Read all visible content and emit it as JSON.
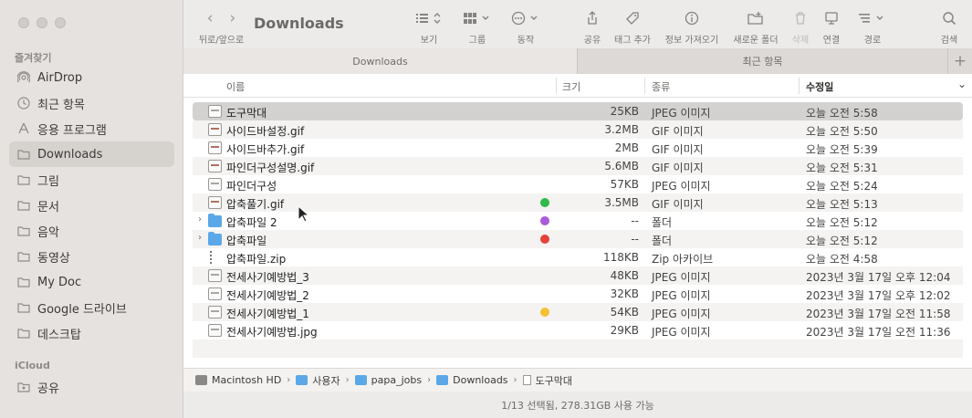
{
  "window": {
    "title": "Downloads"
  },
  "sidebar": {
    "favorites_header": "즐겨찾기",
    "favorites": [
      {
        "label": "AirDrop",
        "icon": "airdrop-icon"
      },
      {
        "label": "최근 항목",
        "icon": "clock-icon"
      },
      {
        "label": "응용 프로그램",
        "icon": "apps-icon"
      },
      {
        "label": "Downloads",
        "icon": "folder-icon",
        "active": true
      },
      {
        "label": "그림",
        "icon": "folder-icon"
      },
      {
        "label": "문서",
        "icon": "folder-icon"
      },
      {
        "label": "음악",
        "icon": "folder-icon"
      },
      {
        "label": "동영상",
        "icon": "folder-icon"
      },
      {
        "label": "My Doc",
        "icon": "folder-icon"
      },
      {
        "label": "Google 드라이브",
        "icon": "folder-icon"
      },
      {
        "label": "데스크탑",
        "icon": "folder-icon"
      }
    ],
    "icloud_header": "iCloud",
    "icloud": [
      {
        "label": "공유",
        "icon": "shared-folder-icon"
      }
    ]
  },
  "toolbar": {
    "nav_label": "뒤로/앞으로",
    "view_label": "보기",
    "group_label": "그룹",
    "action_label": "동작",
    "share_label": "공유",
    "tag_label": "태그 추가",
    "info_label": "정보 가져오기",
    "newfolder_label": "새로운 폴더",
    "delete_label": "삭제",
    "connect_label": "연결",
    "path_label": "경로",
    "search_label": "검색"
  },
  "tabs": [
    {
      "label": "Downloads"
    },
    {
      "label": "최근 항목"
    }
  ],
  "columns": {
    "name": "이름",
    "size": "크기",
    "kind": "종류",
    "date": "수정일"
  },
  "files": [
    {
      "name": "도구막대",
      "size": "25KB",
      "kind": "JPEG 이미지",
      "date": "오늘 오전 5:58",
      "type": "jpeg",
      "selected": true
    },
    {
      "name": "사이드바설정.gif",
      "size": "3.2MB",
      "kind": "GIF 이미지",
      "date": "오늘 오전 5:50",
      "type": "gif"
    },
    {
      "name": "사이드바추가.gif",
      "size": "2MB",
      "kind": "GIF 이미지",
      "date": "오늘 오전 5:39",
      "type": "gif"
    },
    {
      "name": "파인더구성설명.gif",
      "size": "5.6MB",
      "kind": "GIF 이미지",
      "date": "오늘 오전 5:31",
      "type": "gif"
    },
    {
      "name": "파인더구성",
      "size": "57KB",
      "kind": "JPEG 이미지",
      "date": "오늘 오전 5:24",
      "type": "jpeg"
    },
    {
      "name": "압축풀기.gif",
      "size": "3.5MB",
      "kind": "GIF 이미지",
      "date": "오늘 오전 5:13",
      "type": "gif",
      "tag": "#2fb945"
    },
    {
      "name": "압축파일 2",
      "size": "--",
      "kind": "폴더",
      "date": "오늘 오전 5:12",
      "type": "folder",
      "tag": "#a95bd8"
    },
    {
      "name": "압축파일",
      "size": "--",
      "kind": "폴더",
      "date": "오늘 오전 5:12",
      "type": "folder",
      "tag": "#e5413a"
    },
    {
      "name": "압축파일.zip",
      "size": "118KB",
      "kind": "Zip 아카이브",
      "date": "오늘 오전 4:58",
      "type": "zip"
    },
    {
      "name": "전세사기예방법_3",
      "size": "48KB",
      "kind": "JPEG 이미지",
      "date": "2023년 3월 17일 오후 12:04",
      "type": "jpeg"
    },
    {
      "name": "전세사기예방법_2",
      "size": "32KB",
      "kind": "JPEG 이미지",
      "date": "2023년 3월 17일 오후 12:02",
      "type": "jpeg"
    },
    {
      "name": "전세사기예방법_1",
      "size": "54KB",
      "kind": "JPEG 이미지",
      "date": "2023년 3월 17일 오전 11:58",
      "type": "jpeg",
      "tag": "#f5c033"
    },
    {
      "name": "전세사기예방법.jpg",
      "size": "29KB",
      "kind": "JPEG 이미지",
      "date": "2023년 3월 17일 오전 11:36",
      "type": "jpeg"
    }
  ],
  "pathbar": [
    {
      "label": "Macintosh HD",
      "icon": "hd"
    },
    {
      "label": "사용자",
      "icon": "folder"
    },
    {
      "label": "papa_jobs",
      "icon": "folder"
    },
    {
      "label": "Downloads",
      "icon": "folder"
    },
    {
      "label": "도구막대",
      "icon": "file"
    }
  ],
  "status": "1/13 선택됨, 278.31GB 사용 가능"
}
